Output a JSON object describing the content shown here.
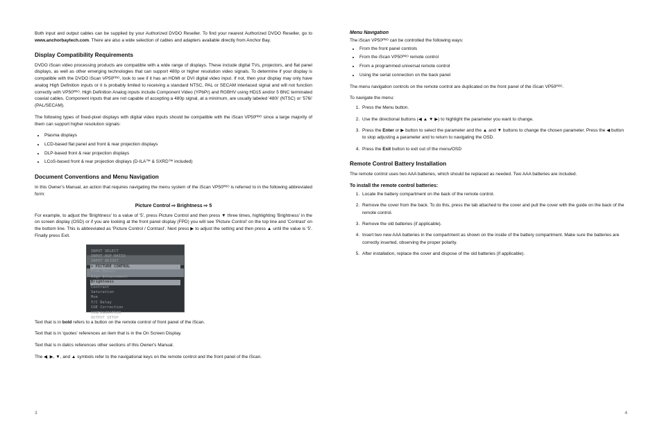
{
  "left": {
    "intro": "Both input and output cables can be supplied by your Authorized DVDO Reseller. To find your nearest Authorized DVDO Reseller, go to",
    "intro_link": "www.anchorbaytech.com",
    "intro2": ". There are also a wide selection of cables and adapters available directly from Anchor Bay.",
    "h1": "Display Compatibility Requirements",
    "p1": "DVDO iScan video processing products are compatible with a wide range of displays. These include digital TVs, projectors, and flat panel displays, as well as other emerging technologies that can support 480p or higher resolution video signals. To determine if your display is compatible with the DVDO iScan VP50ᴾᴿᴼ, look to see if it has an HDMI or DVI digital video input. If not, then your display may only have analog High Definition inputs or it is probably limited to receiving a standard NTSC, PAL or SECAM interlaced signal and will not function correctly with VP50ᴾᴿᴼ. High Definition Analog inputs include Component Video (YPbPr) and RGBHV using HD15 and/or 5 BNC terminated coaxial cables. Component inputs that are not capable of accepting a 480p signal, at a minimum, are usually labeled '480i' (NTSC) or '576i' (PAL/SECAM).",
    "p2": "The following types of fixed-pixel displays with digital video inputs should be compatible with the iScan VP50ᴾᴿᴼ since a large majority of them can support higher resolution signals:",
    "displays": [
      "Plasma displays",
      "LCD-based flat panel and front & rear projection displays",
      "DLP-based front & rear projection displays",
      "LCoS-based front & rear projection displays (D-ILA™ & SXRD™ included)"
    ],
    "h2": "Document Conventions and Menu Navigation",
    "p3_a": "In this Owner's Manual, an action that requires navigating the menu system of the iScan VP50ᴾᴿᴼ is referred to in the following abbreviated form:",
    "menu_example": "Picture Control ⇨ Brightness ⇨ 5",
    "p4": "For example, to adjust the 'Brightness' to a value of '5', press Picture Control and then press ▼ three times, highlighting 'Brightness' in the on screen display (OSD) or if you are looking at the front panel display (FPD) you will see 'Picture Control' on the top line and 'Contrast' on the bottom line. This is abbreviated as 'Picture Control / Contrast'. Next press ▶ to adjust the setting and then press ▲ until the value is '5'. Finally press Exit.",
    "shot": [
      "INPUT SELECT",
      "INPUT ASP RATIO",
      "INPUT ADJUST",
      "> PICTURE CONTROL",
      "Fine Detail",
      "Edge Enhancement",
      "Contrast",
      "Saturation",
      "Hue",
      "Y/C Delay",
      "CUE Correction",
      "CONFIGURATION",
      "OUTPUT SETUP"
    ],
    "shot_hl": "Brightness",
    "p5_a": "Text that is in ",
    "p5_b": "bold",
    "p5_c": " refers to a button on the remote control of front panel of the iScan.",
    "p6": "Text that is in 'quotes' references an item that is in the On Screen Display.",
    "p7_a": "Text that is in ",
    "p7_b": "italics",
    "p7_c": " references other sections of this Owner's Manual.",
    "p8": "The ◀, ▶, ▼, and ▲ symbols refer to the navigational keys on the remote control and the front panel of the iScan."
  },
  "right": {
    "h1": "Menu Navigation",
    "p1": "The iScan VP50ᴾᴿᴼ can be controlled the following ways:",
    "ways": [
      "From the front panel controls",
      "From the iScan VP50ᴾᴿᴼ remote control",
      "From a programmed universal remote control",
      "Using the serial connection on the back panel"
    ],
    "p2": "The menu navigation controls on the remote control are duplicated on the front panel of the iScan VP50ᴾᴿᴼ.",
    "p3": "To navigate the menu:",
    "nav": [
      {
        "a": "Press the Menu button."
      },
      {
        "a": "Use the directional buttons (◀ ▲ ▼ ▶) to highlight the parameter you want to change."
      },
      {
        "a": "Press the ",
        "b": "Enter",
        "c": " or ▶ button to select the parameter and the ▲ and ▼ buttons to change the chosen parameter. Press the ◀ button to stop adjusting a parameter and to return to navigating the OSD."
      },
      {
        "a": "Press the ",
        "b": "Exit",
        "c": " button to exit out of the menu/OSD"
      }
    ],
    "h2": "Remote Control Battery Installation",
    "p4": "The remote control uses two AAA batteries, which should be replaced as needed. Two AAA batteries are included.",
    "h3": "To install the remote control batteries:",
    "steps": [
      "Locate the battery compartment on the back of the remote control.",
      "Remove the cover from the back. To do this, press the tab attached to the cover and pull the cover with the guide on the back of the remote control.",
      "Remove the old batteries (if applicable).",
      "Insert two new AAA batteries in the compartment as shown on the inside of the battery compartment. Make sure the batteries are correctly inserted, observing the proper polarity.",
      "After installation, replace the cover and dispose of the old batteries (if applicable)."
    ]
  },
  "page_left": "3",
  "page_right": "4"
}
